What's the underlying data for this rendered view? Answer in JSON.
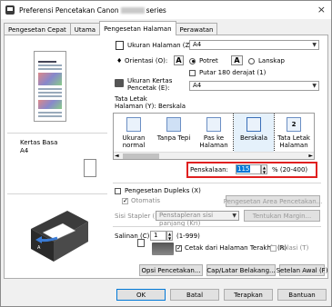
{
  "window": {
    "title_pre": "Preferensi Pencetakan Canon",
    "title_post": "series",
    "close": "×"
  },
  "tabs": [
    "Pengesetan Cepat",
    "Utama",
    "Pengesetan Halaman",
    "Perawatan"
  ],
  "preview": {
    "paper_label": "Kertas Basa",
    "paper_size": "A4"
  },
  "page_size": {
    "label": "Ukuran Halaman (Z):",
    "value": "A4"
  },
  "orientation": {
    "label": "Orientasi (O):",
    "portrait": "Potret",
    "landscape": "Lanskap",
    "portrait_selected": true,
    "rotate": "Putar 180 derajat (1)",
    "rotate_checked": false
  },
  "printer_paper": {
    "label1": "Ukuran Kertas",
    "label2": "Pencetak (E):",
    "value": "A4"
  },
  "layout": {
    "label1": "Tata Letak",
    "label2": "Halaman (Y):",
    "current": "Berskala",
    "items": [
      {
        "line1": "Ukuran normal",
        "line2": ""
      },
      {
        "line1": "Tanpa Tepi",
        "line2": ""
      },
      {
        "line1": "Pas ke",
        "line2": "Halaman"
      },
      {
        "line1": "Berskala",
        "line2": ""
      },
      {
        "line1": "Tata Letak",
        "line2": "Halaman"
      }
    ]
  },
  "scaling": {
    "label": "Penskalaan:",
    "value": "115",
    "range": "% (20-400)"
  },
  "duplex": {
    "label": "Pengesetan Dupleks (X)",
    "checked": false,
    "auto": "Otomatis",
    "area_button": "Pengesetan Area Pencetakan...",
    "stapler_label": "Sisi Stapler (I):",
    "stapler_value": "Penstapleran sisi panjang (Kri)",
    "margin_button": "Tentukan Margin..."
  },
  "copies": {
    "label": "Salinan (C):",
    "value": "1",
    "range": "(1-999)",
    "reverse": "Cetak dari Halaman Terakhir (R)",
    "reverse_checked": true,
    "collate": "Kolasi (T)",
    "collate_checked": false
  },
  "bottom_buttons": {
    "options": "Opsi Pencetakan...",
    "stamp": "Cap/Latar Belakang...",
    "defaults": "Setelan Awal (F)"
  },
  "dialog_buttons": {
    "ok": "OK",
    "cancel": "Batal",
    "apply": "Terapkan",
    "help": "Bantuan"
  }
}
